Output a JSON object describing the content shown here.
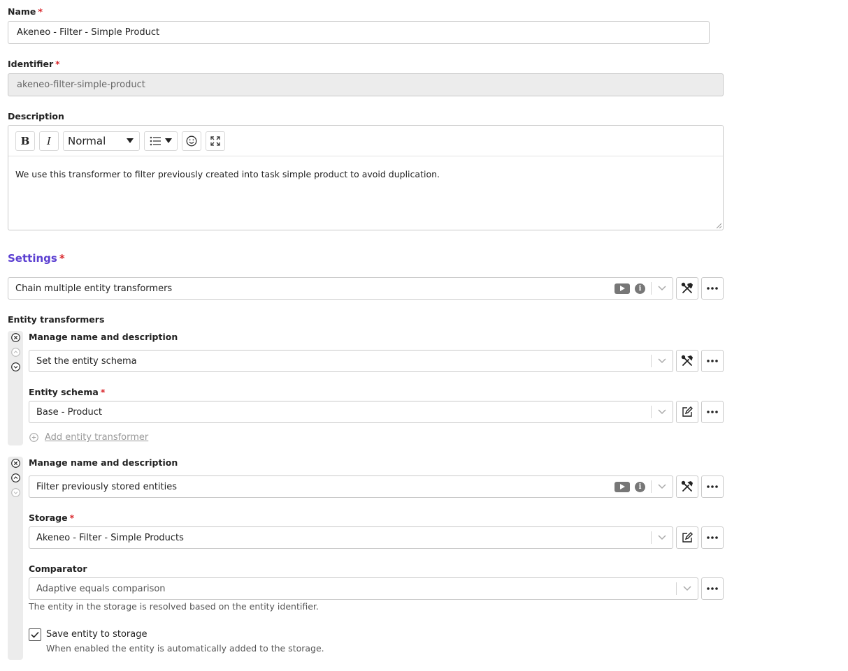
{
  "name": {
    "label": "Name",
    "value": "Akeneo - Filter - Simple Product"
  },
  "identifier": {
    "label": "Identifier",
    "value": "akeneo-filter-simple-product"
  },
  "description": {
    "label": "Description",
    "format_select": "Normal",
    "text": "We use this transformer to filter previously created into task simple product to avoid duplication."
  },
  "settings": {
    "title": "Settings",
    "select_value": "Chain multiple entity transformers"
  },
  "entity_transformers": {
    "label": "Entity transformers",
    "add_label": "Add entity transformer",
    "items": [
      {
        "manage_label": "Manage name and description",
        "select_value": "Set the entity schema",
        "field_label": "Entity schema",
        "field_value": "Base - Product"
      },
      {
        "manage_label": "Manage name and description",
        "select_value": "Filter previously stored entities",
        "storage_label": "Storage",
        "storage_value": "Akeneo - Filter - Simple Products",
        "comparator_label": "Comparator",
        "comparator_value": "Adaptive equals comparison",
        "comparator_hint": "The entity in the storage is resolved based on the entity identifier.",
        "save_label": "Save entity to storage",
        "save_hint": "When enabled the entity is automatically added to the storage.",
        "save_checked": true
      }
    ]
  },
  "colors": {
    "accent": "#5b3fd1",
    "required": "#d9262b"
  }
}
